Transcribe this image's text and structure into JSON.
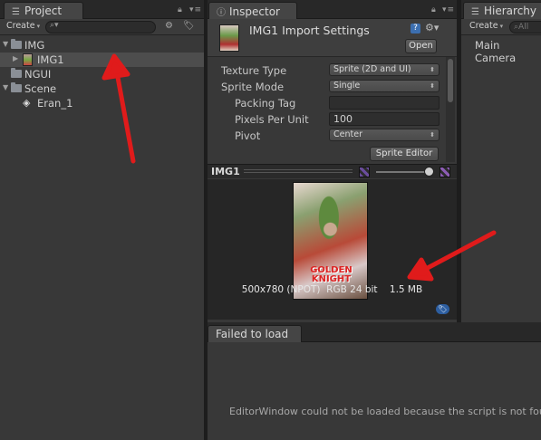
{
  "project": {
    "tab_label": "Project",
    "create_label": "Create",
    "tree": [
      {
        "label": "IMG",
        "type": "folder",
        "expanded": true
      },
      {
        "label": "IMG1",
        "type": "image",
        "selected": true
      },
      {
        "label": "NGUI",
        "type": "folder"
      },
      {
        "label": "Scene",
        "type": "folder",
        "expanded": true
      },
      {
        "label": "Eran_1",
        "type": "scene"
      }
    ]
  },
  "inspector": {
    "tab_label": "Inspector",
    "title": "IMG1 Import Settings",
    "open_label": "Open",
    "props": {
      "texture_type": {
        "label": "Texture Type",
        "value": "Sprite (2D and UI)"
      },
      "sprite_mode": {
        "label": "Sprite Mode",
        "value": "Single"
      },
      "packing_tag": {
        "label": "Packing Tag",
        "value": ""
      },
      "pixels_per_unit": {
        "label": "Pixels Per Unit",
        "value": "100"
      },
      "pivot": {
        "label": "Pivot",
        "value": "Center"
      }
    },
    "sprite_editor_label": "Sprite Editor",
    "preview": {
      "title": "IMG1",
      "info": "500x780 (NPOT)  RGB 24 bit    1.5 MB",
      "cover_text": "GOLDEN KNIGHT"
    }
  },
  "hierarchy": {
    "tab_label": "Hierarchy",
    "create_label": "Create",
    "search_placeholder": "All",
    "items": [
      {
        "label": "Main Camera"
      }
    ]
  },
  "console": {
    "tab_label": "Failed to load",
    "message": "EditorWindow could not be loaded because the script is not found"
  },
  "colors": {
    "annotation_arrow": "#e01b1b",
    "panel_bg": "#383838",
    "selection": "#4d4d4d"
  }
}
